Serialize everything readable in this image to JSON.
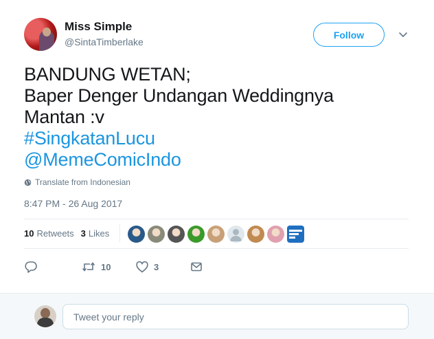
{
  "author": {
    "name": "Miss Simple",
    "handle": "@SintaTimberlake"
  },
  "follow_button": {
    "label": "Follow"
  },
  "tweet": {
    "lines": [
      "BANDUNG WETAN;",
      "Baper Denger Undangan Weddingnya",
      "Mantan :v"
    ],
    "hashtag": "#SingkatanLucu",
    "mention": "@MemeComicIndo",
    "translate_label": "Translate from Indonesian",
    "timestamp": "8:47 PM - 26 Aug 2017"
  },
  "stats": {
    "retweets_count": "10",
    "retweets_label": "Retweets",
    "likes_count": "3",
    "likes_label": "Likes"
  },
  "engagers": [
    {
      "icon": "user-avatar",
      "color": "#2a5a8a"
    },
    {
      "icon": "user-avatar",
      "color": "#8a8a7a"
    },
    {
      "icon": "user-avatar",
      "color": "#555555"
    },
    {
      "icon": "user-avatar",
      "color": "#3a9a2a"
    },
    {
      "icon": "user-avatar",
      "color": "#c8a078"
    },
    {
      "icon": "default-avatar",
      "color": "#aab8c2"
    },
    {
      "icon": "user-avatar",
      "color": "#c08a50"
    },
    {
      "icon": "user-avatar",
      "color": "#e0a0b0"
    },
    {
      "icon": "meme-comic-logo",
      "color": "#1f6fc0"
    }
  ],
  "actions": {
    "reply_icon": "reply-icon",
    "retweet_count": "10",
    "like_count": "3",
    "dm_icon": "envelope-icon"
  },
  "reply_box": {
    "placeholder": "Tweet your reply"
  },
  "colors": {
    "accent": "#1da1f2",
    "link": "#1b95e0",
    "muted": "#657786"
  }
}
